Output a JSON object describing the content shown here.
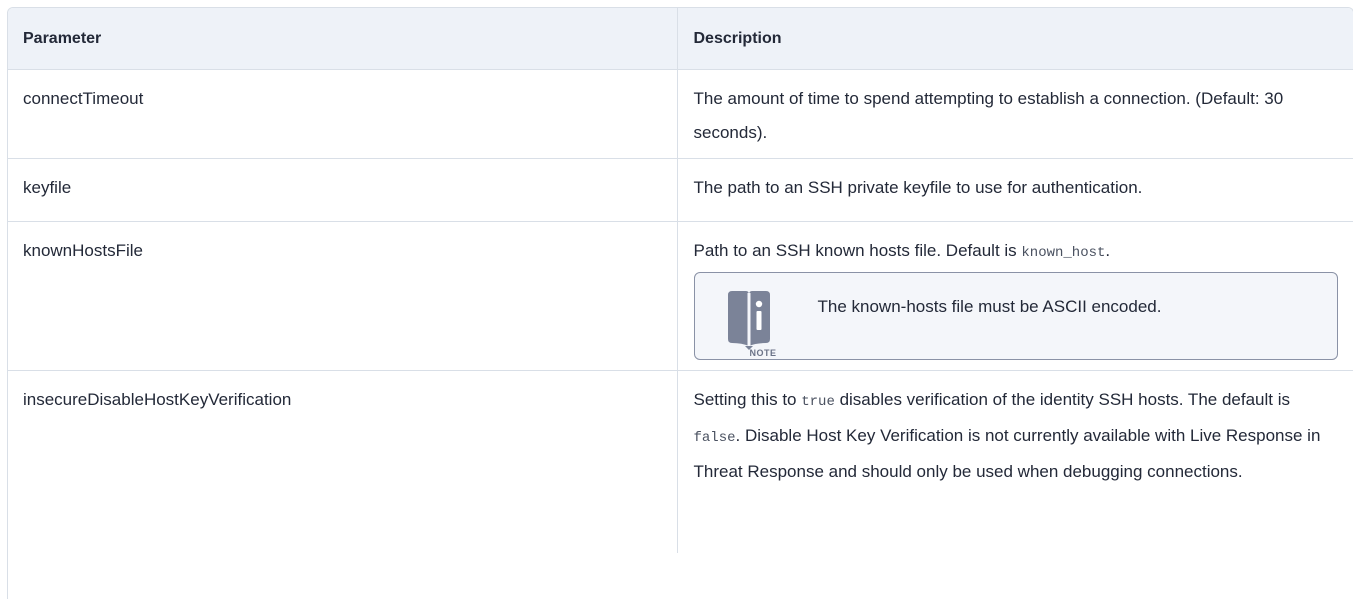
{
  "table": {
    "headers": {
      "parameter": "Parameter",
      "description": "Description"
    },
    "rows": [
      {
        "parameter": "connectTimeout",
        "description": "The amount of time to spend attempting to establish a connection. (Default: 30 seconds)."
      },
      {
        "parameter": "keyfile",
        "description": "The path to an SSH private keyfile to use for authentication."
      },
      {
        "parameter": "knownHostsFile",
        "description_prefix": "Path to an SSH known hosts file. Default is ",
        "description_code": "known_host",
        "description_suffix": ".",
        "note": {
          "label": "NOTE",
          "text": "The known-hosts file must be ASCII encoded.",
          "icon": "book-info-icon"
        }
      },
      {
        "parameter": "insecureDisableHostKeyVerification",
        "description_part1": "Setting this to ",
        "description_code1": "true",
        "description_part2": " disables verification of the identity SSH hosts. The default is ",
        "description_code2": "false",
        "description_part3": ". Disable Host Key Verification is not currently available with Live Response in Threat Response and should only be used when debugging connections."
      }
    ]
  },
  "colors": {
    "header_bg": "#eef2f8",
    "border": "#d9dfe7",
    "note_border": "#8a92a6",
    "note_bg": "#f4f6fa",
    "icon": "#7b8398"
  }
}
